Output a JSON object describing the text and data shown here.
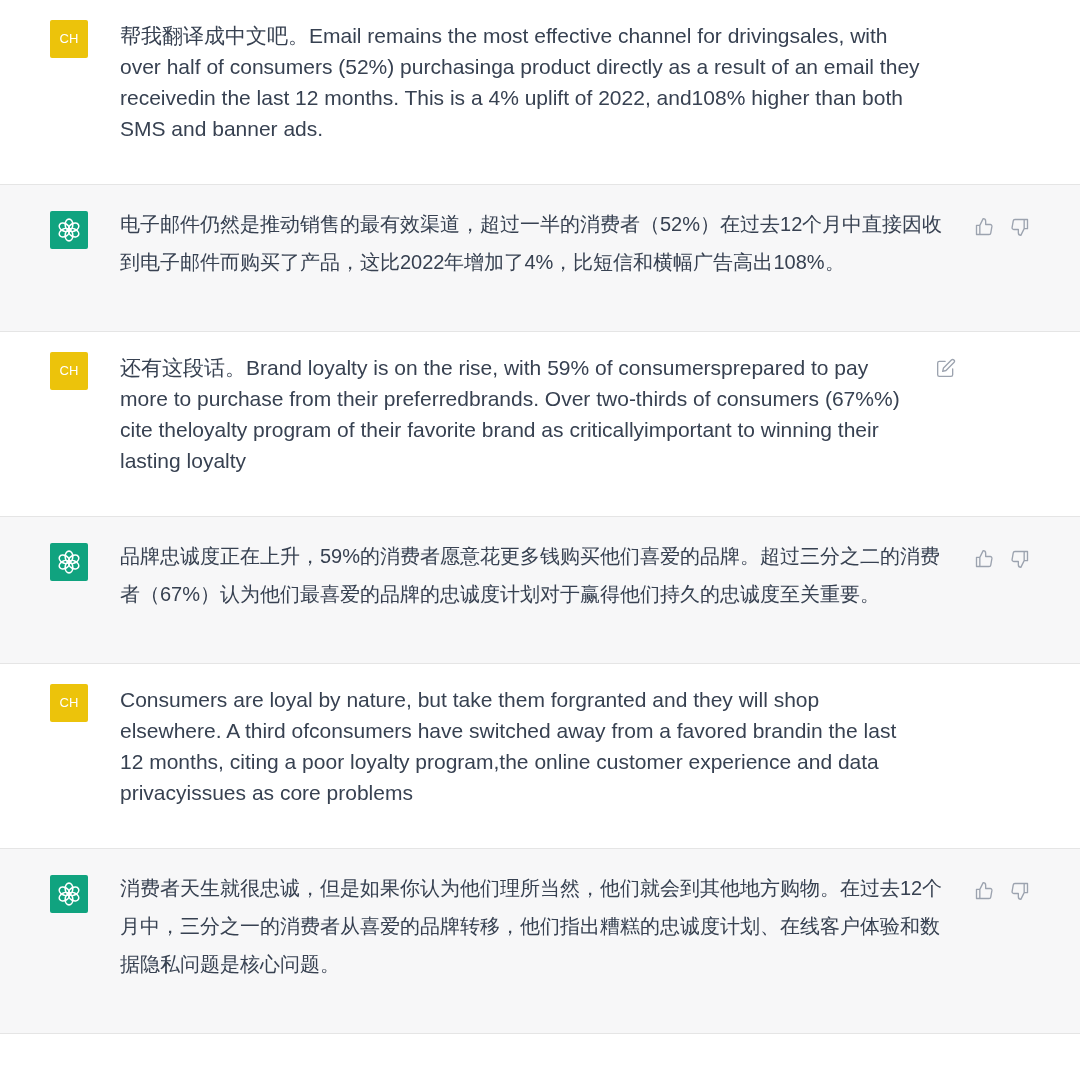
{
  "messages": [
    {
      "kind": "user",
      "avatar": "CH",
      "text": "帮我翻译成中文吧。Email remains the most effective channel for drivingsales, with over half of consumers (52%) purchasinga product directly as a result of an email they receivedin the last 12 months. This is a 4% uplift of 2022, and108% higher than both SMS and banner ads.",
      "edit_icon": false
    },
    {
      "kind": "assistant",
      "text": "电子邮件仍然是推动销售的最有效渠道，超过一半的消费者（52%）在过去12个月中直接因收到电子邮件而购买了产品，这比2022年增加了4%，比短信和横幅广告高出108%。"
    },
    {
      "kind": "user",
      "avatar": "CH",
      "text": "还有这段话。Brand loyalty is on the rise, with 59% of consumersprepared to pay more to purchase from their preferredbrands. Over two-thirds of consumers (67%%) cite theloyalty program of their favorite brand as criticallyimportant to winning their lasting loyalty",
      "edit_icon": true
    },
    {
      "kind": "assistant",
      "text": "品牌忠诚度正在上升，59%的消费者愿意花更多钱购买他们喜爱的品牌。超过三分之二的消费者（67%）认为他们最喜爱的品牌的忠诚度计划对于赢得他们持久的忠诚度至关重要。"
    },
    {
      "kind": "user",
      "avatar": "CH",
      "text": "Consumers are loyal by nature, but take them forgranted and they will shop elsewhere. A third ofconsumers have switched away from a favored brandin the last 12 months, citing a poor loyalty program,the online customer experience and data privacyissues as core problems",
      "edit_icon": false
    },
    {
      "kind": "assistant",
      "text": "消费者天生就很忠诚，但是如果你认为他们理所当然，他们就会到其他地方购物。在过去12个月中，三分之一的消费者从喜爱的品牌转移，他们指出糟糕的忠诚度计划、在线客户体验和数据隐私问题是核心问题。"
    }
  ]
}
